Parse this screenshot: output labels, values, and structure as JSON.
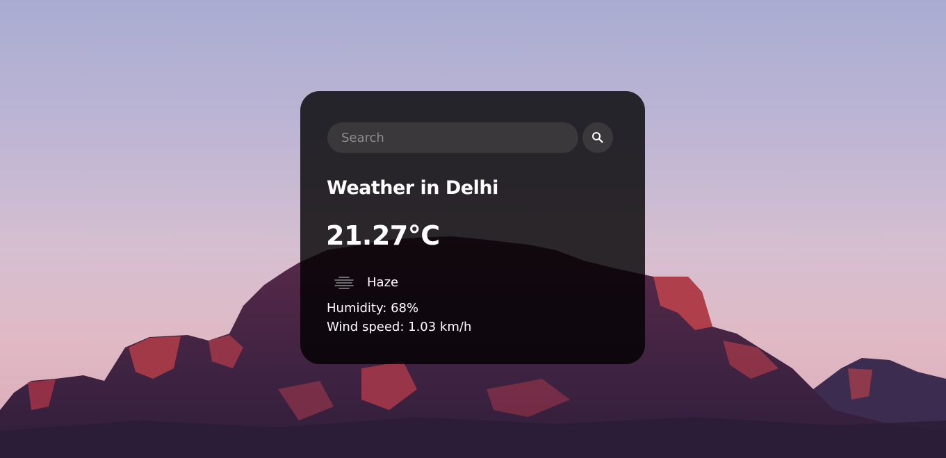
{
  "search": {
    "placeholder": "Search",
    "value": "",
    "button_icon": "search-icon"
  },
  "weather": {
    "title": "Weather in Delhi",
    "temperature": "21.27°C",
    "condition": "Haze",
    "condition_icon": "haze-icon",
    "humidity": "Humidity: 68%",
    "wind": "Wind speed: 1.03 km/h"
  },
  "colors": {
    "card_background": "#000000cc",
    "input_background": "#3a383b",
    "text": "#ffffff",
    "placeholder": "#8e8b8e"
  },
  "background": {
    "description_icon": "mountain-sunset-image"
  }
}
